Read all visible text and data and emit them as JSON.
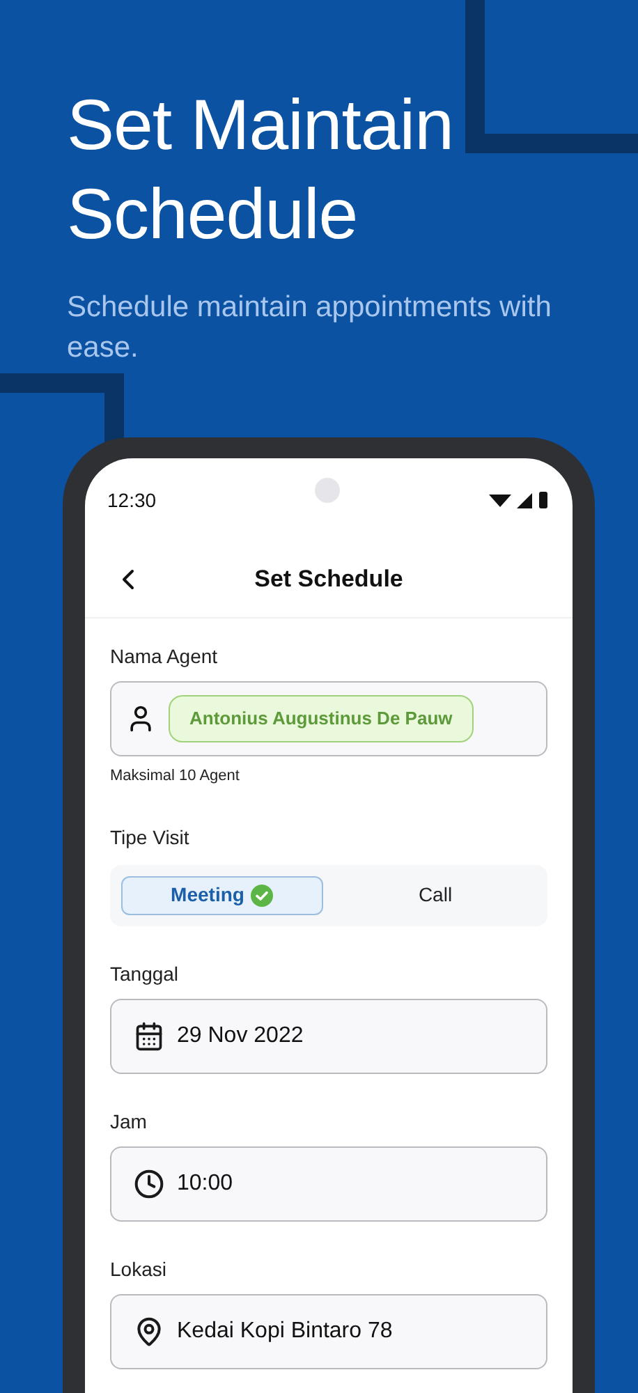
{
  "headline": {
    "title": "Set Maintain Schedule",
    "subtitle": "Schedule maintain appointments with ease."
  },
  "status_bar": {
    "time": "12:30"
  },
  "app_bar": {
    "title": "Set Schedule"
  },
  "agent_field": {
    "label": "Nama Agent",
    "chips": [
      "Antonius Augustinus De Pauw"
    ],
    "hint": "Maksimal 10 Agent"
  },
  "visit_type": {
    "label": "Tipe Visit",
    "options": [
      {
        "label": "Meeting",
        "selected": true
      },
      {
        "label": "Call",
        "selected": false
      }
    ]
  },
  "fields": [
    {
      "kind": "date",
      "label": "Tanggal",
      "value": "29 Nov 2022"
    },
    {
      "kind": "time",
      "label": "Jam",
      "value": "10:00"
    },
    {
      "kind": "location",
      "label": "Lokasi",
      "value": "Kedai Kopi Bintaro 78"
    }
  ]
}
